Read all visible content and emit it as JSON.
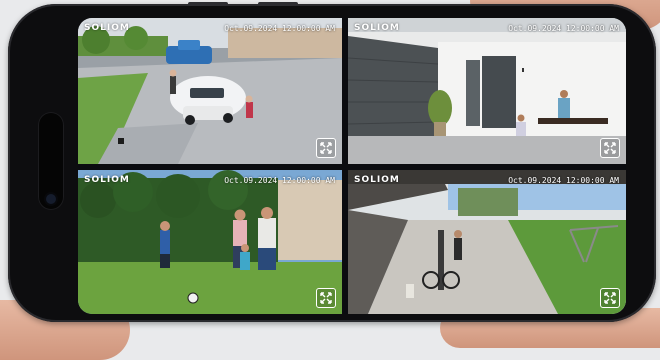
{
  "app": {
    "brand": "SOLIOM"
  },
  "feeds": [
    {
      "brand": "SOLIOM",
      "timestamp": "Oct.09.2024  12:00:00  AM"
    },
    {
      "brand": "SOLIOM",
      "timestamp": "Oct.09.2024  12:00:00  AM"
    },
    {
      "brand": "SOLIOM",
      "timestamp": "Oct.09.2024  12:00:00  AM"
    },
    {
      "brand": "SOLIOM",
      "timestamp": "Oct.09.2024  12:00:00  AM"
    }
  ],
  "icons": {
    "expand": "fullscreen-expand-icon"
  },
  "colors": {
    "phone": "#0d0d0f",
    "overlay_text": "#ffffff",
    "grass": "#5d9a3b"
  }
}
